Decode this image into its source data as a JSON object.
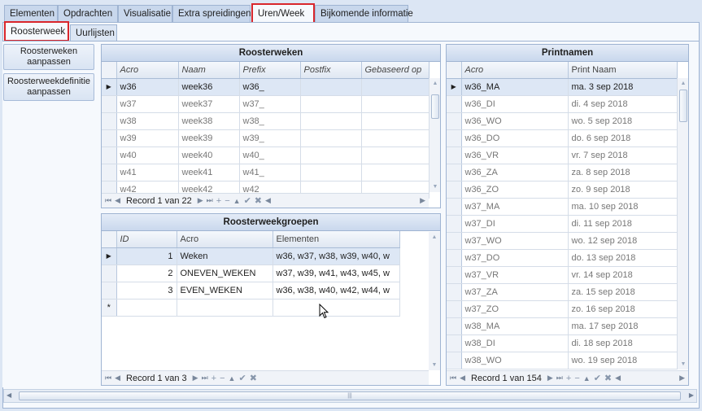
{
  "tabs": [
    "Elementen",
    "Opdrachten",
    "Visualisatie",
    "Extra spreidingen",
    "Uren/Week",
    "Bijkomende informatie"
  ],
  "subtabs": [
    "Roosterweek",
    "Uurlijsten"
  ],
  "side": {
    "btn1": "Roosterweken aanpassen",
    "btn2": "Roosterweekdefinitie aanpassen"
  },
  "roosterweken": {
    "title": "Roosterweken",
    "columns": [
      "Acro",
      "Naam",
      "Prefix",
      "Postfix",
      "Gebaseerd op"
    ],
    "rows": [
      [
        "w36",
        "week36",
        "w36_",
        "",
        ""
      ],
      [
        "w37",
        "week37",
        "w37_",
        "",
        ""
      ],
      [
        "w38",
        "week38",
        "w38_",
        "",
        ""
      ],
      [
        "w39",
        "week39",
        "w39_",
        "",
        ""
      ],
      [
        "w40",
        "week40",
        "w40_",
        "",
        ""
      ],
      [
        "w41",
        "week41",
        "w41_",
        "",
        ""
      ],
      [
        "w42",
        "week42",
        "w42",
        "",
        ""
      ]
    ],
    "record": "Record 1 van 22"
  },
  "groepen": {
    "title": "Roosterweekgroepen",
    "columns": [
      "ID",
      "Acro",
      "Elementen"
    ],
    "rows": [
      [
        "1",
        "Weken",
        "w36, w37, w38, w39, w40, w"
      ],
      [
        "2",
        "ONEVEN_WEKEN",
        "w37, w39, w41, w43, w45, w"
      ],
      [
        "3",
        "EVEN_WEKEN",
        "w36, w38, w40, w42, w44, w"
      ]
    ],
    "newrow": "*",
    "record": "Record 1 van 3"
  },
  "printnamen": {
    "title": "Printnamen",
    "columns": [
      "Acro",
      "Print Naam"
    ],
    "rows": [
      [
        "w36_MA",
        "ma. 3 sep 2018"
      ],
      [
        "w36_DI",
        "di. 4 sep 2018"
      ],
      [
        "w36_WO",
        "wo. 5 sep 2018"
      ],
      [
        "w36_DO",
        "do. 6 sep 2018"
      ],
      [
        "w36_VR",
        "vr. 7 sep 2018"
      ],
      [
        "w36_ZA",
        "za. 8 sep 2018"
      ],
      [
        "w36_ZO",
        "zo. 9 sep 2018"
      ],
      [
        "w37_MA",
        "ma. 10 sep 2018"
      ],
      [
        "w37_DI",
        "di. 11 sep 2018"
      ],
      [
        "w37_WO",
        "wo. 12 sep 2018"
      ],
      [
        "w37_DO",
        "do. 13 sep 2018"
      ],
      [
        "w37_VR",
        "vr. 14 sep 2018"
      ],
      [
        "w37_ZA",
        "za. 15 sep 2018"
      ],
      [
        "w37_ZO",
        "zo. 16 sep 2018"
      ],
      [
        "w38_MA",
        "ma. 17 sep 2018"
      ],
      [
        "w38_DI",
        "di. 18 sep 2018"
      ],
      [
        "w38_WO",
        "wo. 19 sep 2018"
      ]
    ],
    "record": "Record 1 van 154"
  },
  "nav": {
    "first": "⏮",
    "prev": "◀",
    "next": "▶",
    "last": "⏭",
    "add": "+",
    "del": "−",
    "up": "▲",
    "ok": "✔",
    "cancel": "✖"
  },
  "indicator": "▶",
  "colors": {
    "highlight": "#d9262c",
    "selected": "#dde7f5"
  }
}
